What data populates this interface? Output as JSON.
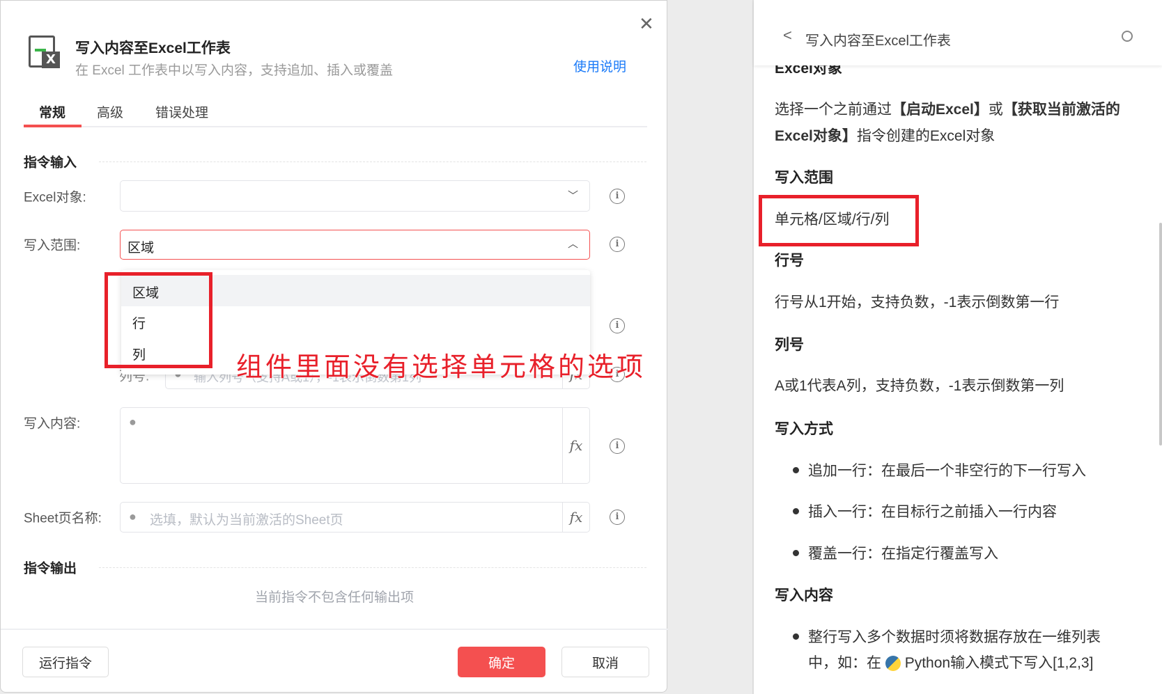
{
  "dialog": {
    "title": "写入内容至Excel工作表",
    "subtitle": "在 Excel 工作表中以写入内容，支持追加、插入或覆盖",
    "help_link": "使用说明",
    "tabs": [
      {
        "label": "常规",
        "active": true
      },
      {
        "label": "高级"
      },
      {
        "label": "错误处理"
      }
    ],
    "input_section": "指令输入",
    "fields": {
      "excel_object": {
        "label": "Excel对象:",
        "value": ""
      },
      "write_range": {
        "label": "写入范围:",
        "value": "区域",
        "options": [
          "区域",
          "行",
          "列"
        ]
      },
      "column": {
        "label": "列号:",
        "placeholder": "输入列号（支持A或1），-1表示倒数第1列"
      },
      "content": {
        "label": "写入内容:",
        "value": ""
      },
      "sheet": {
        "label": "Sheet页名称:",
        "placeholder": "选填，默认为当前激活的Sheet页"
      }
    },
    "output_section": "指令输出",
    "output_empty": "当前指令不包含任何输出项",
    "buttons": {
      "run": "运行指令",
      "ok": "确定",
      "cancel": "取消"
    },
    "annotation": "组件里面没有选择单元格的选项",
    "accent": "#f45050"
  },
  "help": {
    "title": "写入内容至Excel工作表",
    "cut_heading": "Excel对象",
    "p1a": "选择一个之前通过",
    "p1b": "【启动Excel】",
    "p1c": "或",
    "p1d": "【获取当前激活的",
    "p1e": "Excel对象】",
    "p1f": "指令创建的Excel对象",
    "h_range": "写入范围",
    "range_text": "单元格/区域/行/列",
    "h_row": "行号",
    "row_text": "行号从1开始，支持负数，-1表示倒数第一行",
    "h_col": "列号",
    "col_text": "A或1代表A列，支持负数，-1表示倒数第一列",
    "h_mode": "写入方式",
    "modes": [
      "追加一行：在最后一个非空行的下一行写入",
      "插入一行：在目标行之前插入一行内容",
      "覆盖一行：在指定行覆盖写入"
    ],
    "h_content": "写入内容",
    "content_line1": "整行写入多个数据时须将数据存放在一维列表",
    "content_line2a": "中，如：在",
    "content_line2b": "Python输入模式下写入[1,2,3]"
  }
}
